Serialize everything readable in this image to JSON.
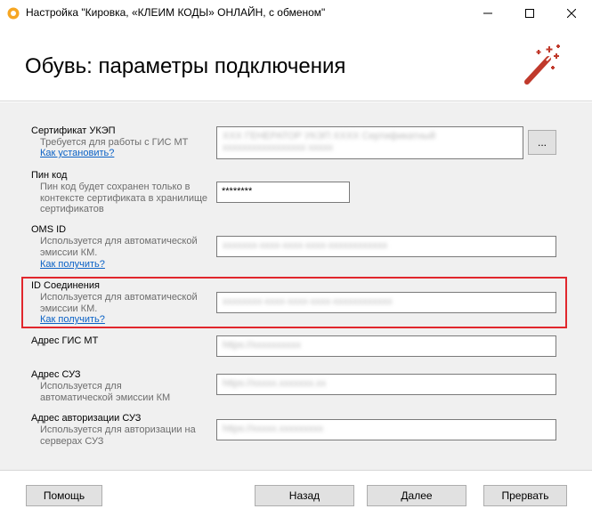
{
  "window": {
    "title": "Настройка \"Кировка, «КЛЕИМ КОДЫ» ОНЛАЙН, с обменом\"",
    "icons": [
      "app-icon",
      "minimize-icon",
      "maximize-icon",
      "close-icon"
    ]
  },
  "header": {
    "title": "Обувь: параметры подключения",
    "icon": "magic-wand-icon"
  },
  "fields": {
    "certificate": {
      "label": "Сертификат УКЭП",
      "hint": "Требуется для работы с ГИС МТ",
      "link": "Как установить?",
      "value_line1": "XXX ГЕНЕРАТОР УКЭП XXXX Сертификатный",
      "value_line2": "xxxxxxxxxxxxxxxxx xxxxx",
      "browse_label": "..."
    },
    "pin": {
      "label": "Пин код",
      "hint": "Пин код будет сохранен только в контексте сертификата в хранилище сертификатов",
      "value": "********"
    },
    "oms_id": {
      "label": "OMS ID",
      "hint": "Используется для автоматической эмиссии КМ.",
      "link": "Как получить?",
      "value": "xxxxxxx-xxxx-xxxx-xxxx-xxxxxxxxxxxx"
    },
    "connection_id": {
      "label": "ID Соединения",
      "hint": "Используется для автоматической эмиссии КМ.",
      "link": "Как получить?",
      "value": "xxxxxxxx-xxxx-xxxx-xxxx-xxxxxxxxxxxx"
    },
    "gis_mt_address": {
      "label": "Адрес ГИС МТ",
      "value": "https://xxxxxxxxxx"
    },
    "suz_address": {
      "label": "Адрес СУЗ",
      "hint": "Используется для автоматической эмиссии КМ",
      "value": "https://xxxxx.xxxxxxx.xx"
    },
    "suz_auth_address": {
      "label": "Адрес авторизации СУЗ",
      "hint": "Используется для авторизации на серверах СУЗ",
      "value": "https://xxxxx.xxxxxxxxx"
    }
  },
  "footer": {
    "help": "Помощь",
    "back": "Назад",
    "next": "Далее",
    "abort": "Прервать"
  },
  "colors": {
    "highlight": "#e1272d",
    "link": "#0b62c6",
    "wand": "#c0392b"
  }
}
